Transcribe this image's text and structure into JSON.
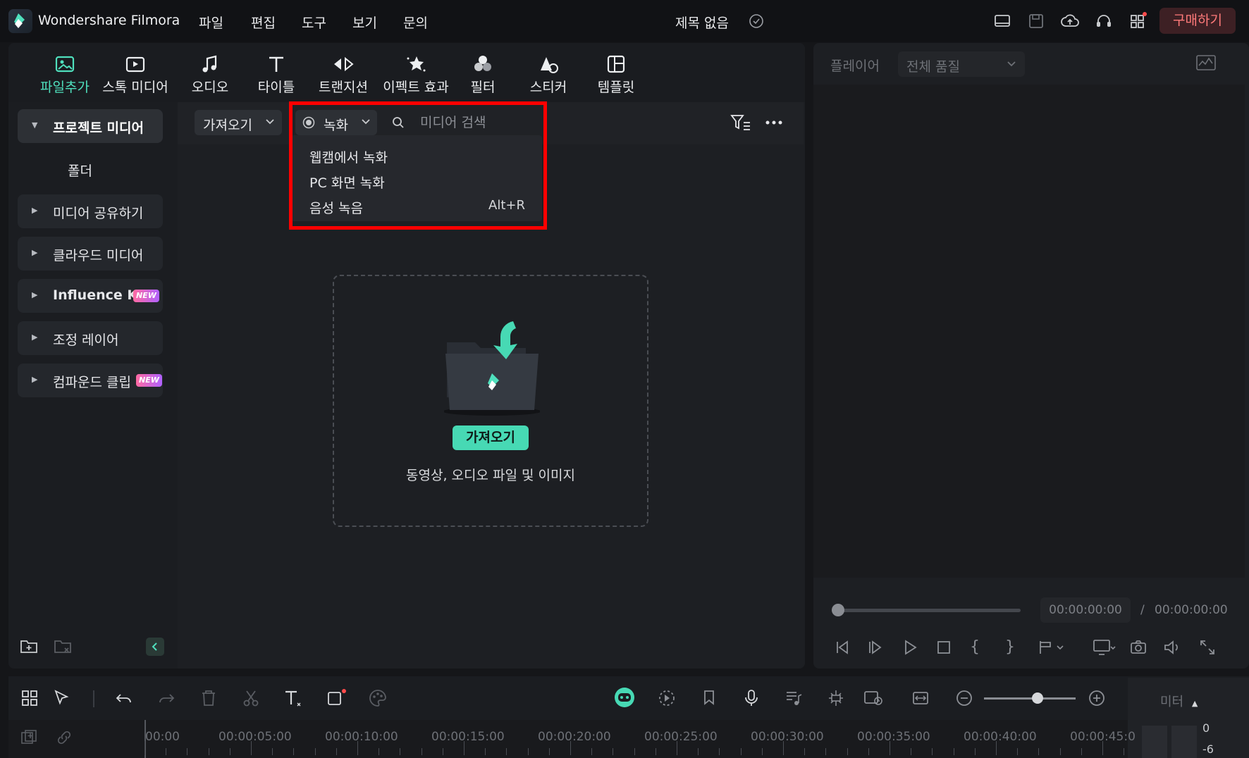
{
  "app": {
    "name": "Wondershare Filmora",
    "doc_title": "제목 없음",
    "buy_label": "구매하기"
  },
  "menu": [
    "파일",
    "편집",
    "도구",
    "보기",
    "문의"
  ],
  "toolbar": [
    {
      "label": "파일추가",
      "icon": "media-import-icon"
    },
    {
      "label": "스톡 미디어",
      "icon": "stock-media-icon"
    },
    {
      "label": "오디오",
      "icon": "music-note-icon"
    },
    {
      "label": "타이틀",
      "icon": "text-title-icon"
    },
    {
      "label": "트랜지션",
      "icon": "transition-icon"
    },
    {
      "label": "이펙트 효과",
      "icon": "effects-sparkle-icon"
    },
    {
      "label": "필터",
      "icon": "filter-icon"
    },
    {
      "label": "스티커",
      "icon": "sticker-icon"
    },
    {
      "label": "템플릿",
      "icon": "template-icon"
    }
  ],
  "sidebar": {
    "project_media": "프로젝트 미디어",
    "folder": "폴더",
    "items": [
      "미디어 공유하기",
      "클라우드 미디어",
      "Influence Kit",
      "조정 레이어",
      "컴파운드 클립"
    ],
    "new_badge": "NEW"
  },
  "media": {
    "import_label": "가져오기",
    "record_label": "녹화",
    "search_placeholder": "미디어 검색",
    "record_menu": [
      {
        "label": "웹캠에서 녹화",
        "shortcut": ""
      },
      {
        "label": "PC 화면 녹화",
        "shortcut": ""
      },
      {
        "label": "음성 녹음",
        "shortcut": "Alt+R"
      }
    ],
    "drop_button": "가져오기",
    "drop_hint": "동영상, 오디오 파일 및 이미지"
  },
  "player": {
    "label": "플레이어",
    "quality": "전체 품질",
    "time_current": "00:00:00:00",
    "time_sep": "/",
    "time_total": "00:00:00:00"
  },
  "timeline": {
    "meter_label": "미터",
    "ticks": [
      "00:00",
      "00:00:05:00",
      "00:00:10:00",
      "00:00:15:00",
      "00:00:20:00",
      "00:00:25:00",
      "00:00:30:00",
      "00:00:35:00",
      "00:00:40:00",
      "00:00:45:0"
    ],
    "meter_values": [
      "0",
      "-6"
    ],
    "zoom_level": 0.55
  },
  "colors": {
    "accent": "#47d9b4",
    "highlight": "#ff0000",
    "buy_text": "#ff7a7a"
  }
}
